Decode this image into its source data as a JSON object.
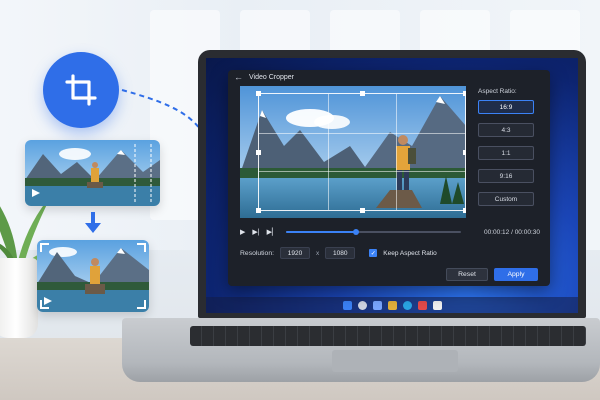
{
  "app": {
    "title": "Video Cropper",
    "back_icon": "back-arrow-icon"
  },
  "aspect_ratio": {
    "label": "Aspect Ratio:",
    "options": [
      "16:9",
      "4:3",
      "1:1",
      "9:16",
      "Custom"
    ],
    "selected": "16:9"
  },
  "playback": {
    "time": "00:00:12 / 00:00:30",
    "progress": 0.4,
    "icons": [
      "play-icon",
      "step-forward-icon",
      "skip-end-icon"
    ]
  },
  "resolution": {
    "label": "Resolution:",
    "width": "1920",
    "separator": "x",
    "height": "1080",
    "keep_aspect_label": "Keep Aspect Ratio",
    "keep_aspect_checked": true
  },
  "buttons": {
    "reset": "Reset",
    "apply": "Apply"
  },
  "colors": {
    "accent": "#2f6ee8",
    "app_bg": "#1d2129",
    "active_border": "#3b82f6"
  }
}
